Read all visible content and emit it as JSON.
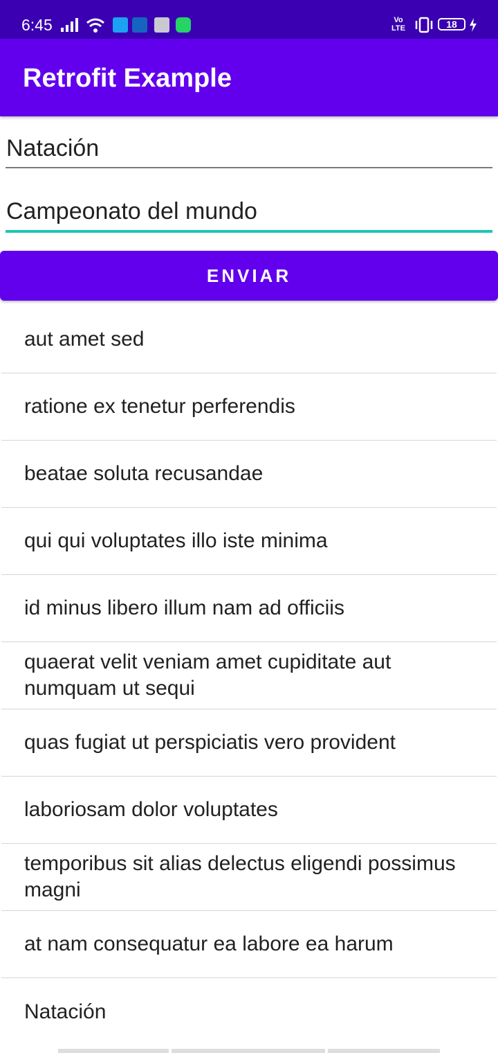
{
  "status_bar": {
    "time": "6:45",
    "volte": "Vo\nLTE",
    "battery": "18",
    "icons": [
      "signal-icon",
      "wifi-icon",
      "twitter-icon",
      "usb-icon",
      "drive-icon",
      "whatsapp-icon",
      "vibrate-icon",
      "battery-icon",
      "charging-icon"
    ]
  },
  "app_bar": {
    "title": "Retrofit Example",
    "color": "#6200ee"
  },
  "form": {
    "field_1_value": "Natación",
    "field_2_value": "Campeonato del mundo",
    "focus_color": "#1cc6b6",
    "send_label": "ENVIAR"
  },
  "list": {
    "items": [
      "aut amet sed",
      "ratione ex tenetur perferendis",
      "beatae soluta recusandae",
      "qui qui voluptates illo iste minima",
      "id minus libero illum nam ad officiis",
      "quaerat velit veniam amet cupiditate aut numquam ut sequi",
      "quas fugiat ut perspiciatis vero provident",
      "laboriosam dolor voluptates",
      "temporibus sit alias delectus eligendi possimus magni",
      "at nam consequatur ea labore ea harum",
      "Natación"
    ]
  }
}
